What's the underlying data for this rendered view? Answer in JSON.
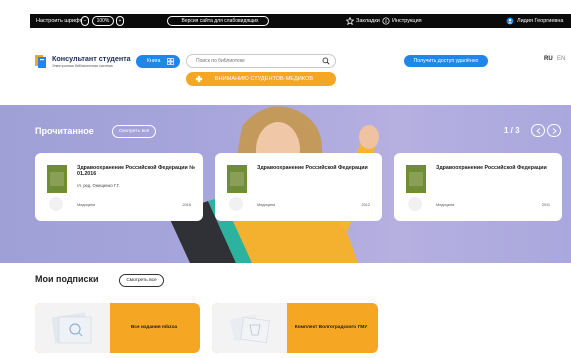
{
  "topbar": {
    "font_settings": "Настроить шрифт",
    "zoom": "100%",
    "low_vision": "Версия сайта для слабовидящих",
    "bookmarks": "Закладки",
    "instruction": "Инструкция",
    "user": "Лидия Георгиевна"
  },
  "header": {
    "logo_title": "Консультант студента",
    "logo_subtitle": "Электронная библиотечная система",
    "kniga_button": "Книга",
    "search_placeholder": "Поиск по библиотеке",
    "medic_banner": "ВНИМАНИЮ СТУДЕНТОВ-МЕДИКОВ",
    "access_button": "Получить доступ удалённо",
    "lang_ru": "RU",
    "lang_en": "EN"
  },
  "hero": {
    "title": "Прочитанное",
    "see_all": "Смотреть всё",
    "pager": "1 / 3",
    "cards": [
      {
        "title": "Здравоохранение Российской Федерации № 01.2016",
        "author": "гл. ред. Онищенко Г.Г.",
        "category": "Медицина",
        "year": "2016"
      },
      {
        "title": "Здравоохранение Российской Федерации",
        "author": "",
        "category": "Медицина",
        "year": "2012"
      },
      {
        "title": "Здравоохранение Российской Федерации",
        "author": "",
        "category": "Медицина",
        "year": "2011"
      }
    ]
  },
  "subscriptions": {
    "title": "Мои подписки",
    "see_all": "Смотреть все",
    "items": [
      {
        "label": "Все издания mbzoa"
      },
      {
        "label": "Комплект Волгоградского ГМУ"
      }
    ]
  },
  "colors": {
    "accent_blue": "#1f86ea",
    "accent_orange": "#f5a623",
    "hero_bg": "#a8a6dc",
    "topbar_bg": "#0b0b0b"
  },
  "icons": [
    "low-vision-icon",
    "star-icon",
    "info-icon",
    "user-icon",
    "logo-icon",
    "grid-icon",
    "search-icon",
    "chevron-left-icon",
    "chevron-right-icon"
  ]
}
